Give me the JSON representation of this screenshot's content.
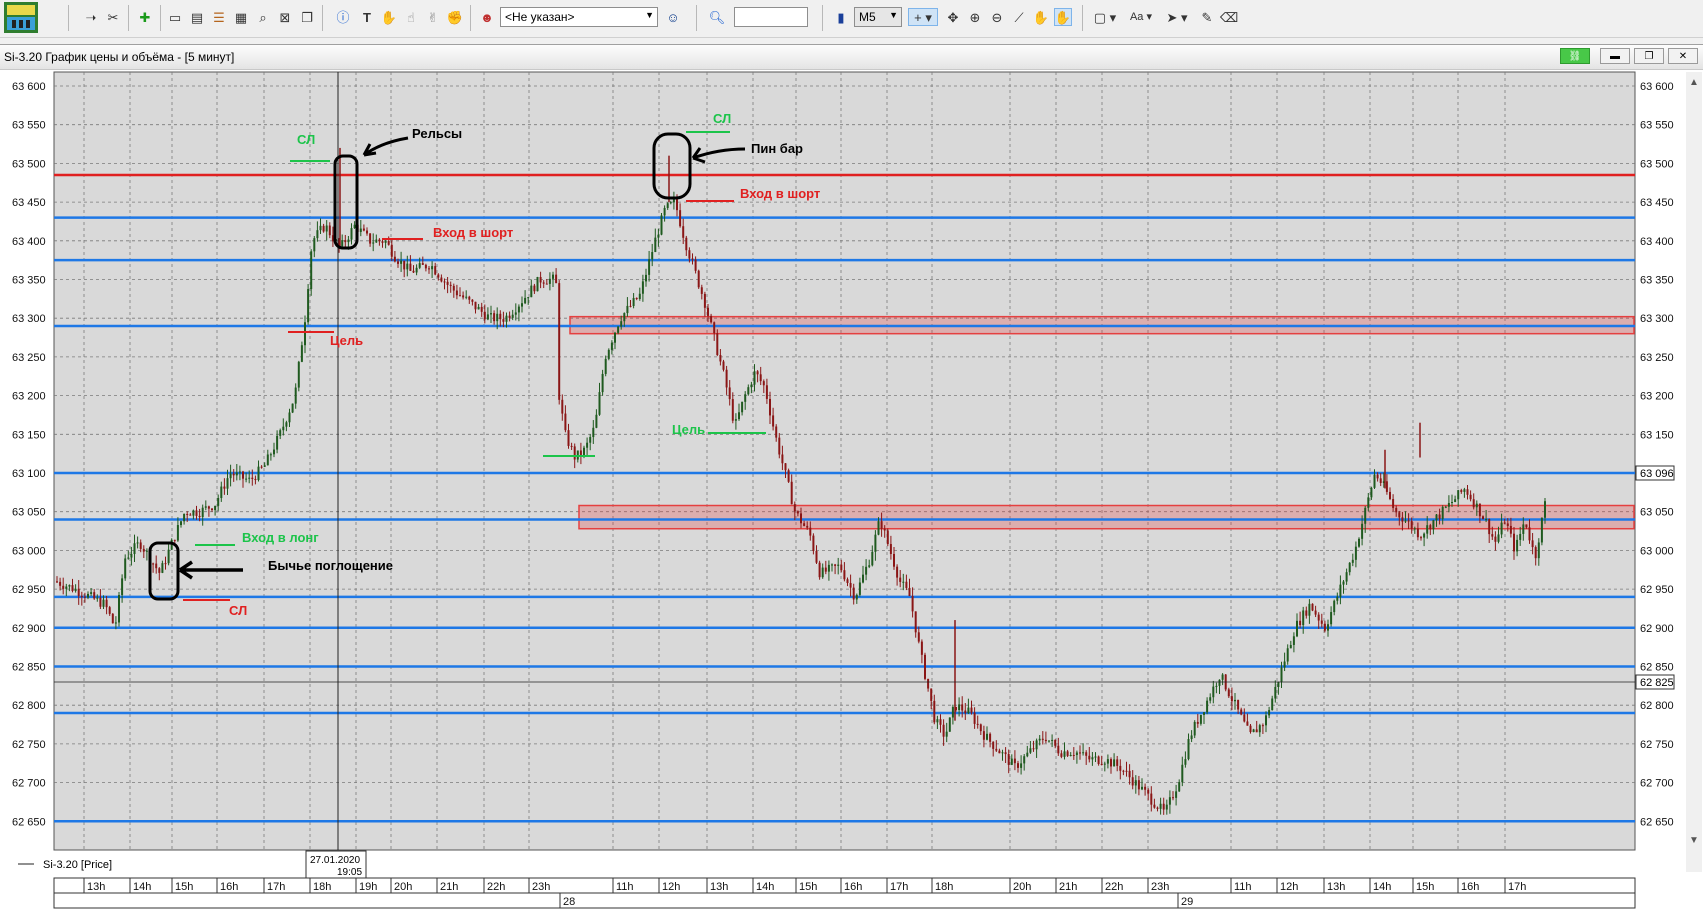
{
  "toolbar": {
    "account_value": "<Не указан>",
    "search_value": "",
    "timeframe_value": "M5",
    "text_size_label": "Aa",
    "icons": [
      "logo-icon",
      "cursor-icon",
      "scissors-icon",
      "new-chart-icon",
      "window-icon",
      "chart-icon",
      "list-icon",
      "table-icon",
      "zoom-window-icon",
      "close-window-icon",
      "copy-icon",
      "info-icon",
      "text-tool-icon",
      "hand-icon",
      "hand2-icon",
      "hand3-icon",
      "hand4-icon",
      "person-icon",
      "person-search-icon",
      "search-icon",
      "bar-chart-icon",
      "plus-icon",
      "move-icon",
      "zoom-in-icon",
      "zoom-out-icon",
      "ruler-icon",
      "hand-drag-icon",
      "hand-active-icon",
      "rectangle-icon",
      "arrow-icon",
      "pen-icon",
      "eraser-icon"
    ]
  },
  "window": {
    "title": "Si-3.20 График цены и объёма - [5 минут]",
    "buttons": [
      "link-icon",
      "minimize-icon",
      "restore-icon",
      "close-icon"
    ]
  },
  "chart": {
    "legend_label": "Si-3.20 [Price]",
    "last_price_label": "63 096",
    "crosshair_price_label": "62 825",
    "crosshair_date": "27.01.2020",
    "crosshair_time": "19:05",
    "grid_color": "#7a7a7a",
    "background": "#d9d9d9"
  },
  "chart_data": {
    "type": "candlestick",
    "instrument": "Si-3.20",
    "timeframe": "5 минут",
    "ylim": [
      62620,
      63625
    ],
    "y_ticks": [
      "63 600",
      "63 550",
      "63 500",
      "63 450",
      "63 400",
      "63 350",
      "63 300",
      "63 250",
      "63 200",
      "63 150",
      "63 100",
      "63 050",
      "63 000",
      "62 950",
      "62 900",
      "62 850",
      "62 800",
      "62 750",
      "62 700",
      "62 650"
    ],
    "y_tick_values": [
      63600,
      63550,
      63500,
      63450,
      63400,
      63350,
      63300,
      63250,
      63200,
      63150,
      63100,
      63050,
      63000,
      62950,
      62900,
      62850,
      62800,
      62750,
      62700,
      62650
    ],
    "x_ticks": [
      "13h",
      "14h",
      "15h",
      "16h",
      "17h",
      "18h",
      "19h",
      "20h",
      "21h",
      "22h",
      "23h",
      "11h",
      "12h",
      "13h",
      "14h",
      "15h",
      "16h",
      "17h",
      "18h",
      "20h",
      "21h",
      "22h",
      "23h",
      "11h",
      "12h",
      "13h",
      "14h",
      "15h",
      "16h",
      "17h"
    ],
    "day_labels": [
      {
        "label": "28",
        "index": 11
      },
      {
        "label": "29",
        "index": 23
      }
    ],
    "horizontal_levels_blue": [
      63430,
      63375,
      63290,
      63100,
      63040,
      62940,
      62900,
      62850,
      62790,
      62650
    ],
    "horizontal_levels_red": [
      63485
    ],
    "zones": [
      {
        "from": 63280,
        "to": 63302,
        "color": "#e54040"
      },
      {
        "from": 63028,
        "to": 63058,
        "color": "#e54040"
      }
    ],
    "colors": {
      "up": "#1f5a1f",
      "down": "#8a1616",
      "blue_level": "#1e78e6",
      "red_level": "#e02020",
      "green_mark": "#1cc44a"
    }
  },
  "annotations": {
    "sl1": "СЛ",
    "rails": "Рельсы",
    "short_entry1": "Вход в шорт",
    "target1": "Цель",
    "sl2": "СЛ",
    "pin_bar": "Пин бар",
    "short_entry2": "Вход в шорт",
    "target2": "Цель",
    "long_entry": "Вход в лонг",
    "bull_engulf": "Бычье поглощение",
    "sl3": "СЛ"
  }
}
